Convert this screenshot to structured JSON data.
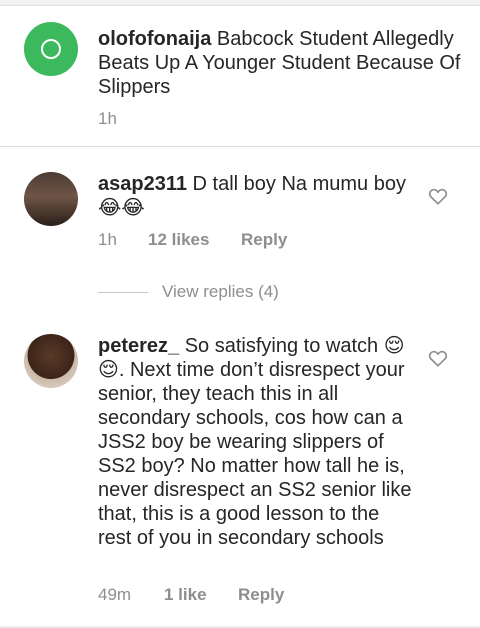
{
  "caption": {
    "username": "olofofonaija",
    "text": "Babcock Student Allegedly Beats Up A Younger Student Because Of Slippers",
    "time": "1h"
  },
  "comments": [
    {
      "username": "asap2311",
      "text": "D tall boy Na mumu boy 😂😂",
      "time": "1h",
      "likes": "12 likes",
      "reply_label": "Reply",
      "view_replies": "View replies (4)"
    },
    {
      "username": "peterez_",
      "text": "So satisfying to watch 😌😌. Next time don’t disrespect your senior, they teach this in all secondary schools, cos how can a JSS2 boy be wearing slippers of SS2 boy? No matter how tall he is, never disrespect an SS2 senior like that, this is a good lesson to the rest of you in secondary schools",
      "time": "49m",
      "likes": "1 like",
      "reply_label": "Reply"
    }
  ],
  "icons": {
    "heart": "heart-outline-icon"
  },
  "colors": {
    "avatar_green": "#3cb95c",
    "meta_gray": "#8e8e8e",
    "text": "#262626"
  }
}
